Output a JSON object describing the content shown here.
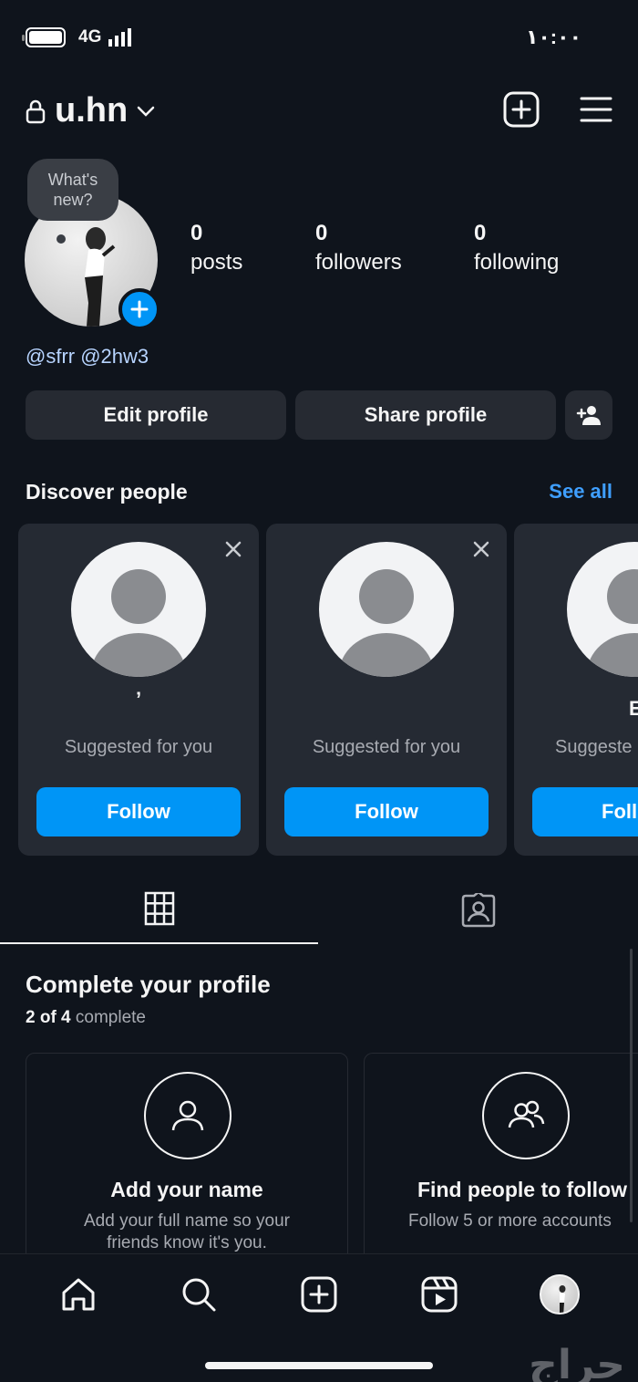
{
  "status_bar": {
    "time": "١٠:٠٠",
    "network": "4G"
  },
  "header": {
    "username": "u.hn",
    "icons": [
      "lock-icon",
      "chevron-down-icon",
      "new-post-icon",
      "menu-icon"
    ]
  },
  "profile": {
    "note_bubble": "What's new?",
    "stats": [
      {
        "value": "0",
        "label": "posts"
      },
      {
        "value": "0",
        "label": "followers"
      },
      {
        "value": "0",
        "label": "following"
      }
    ],
    "bio": "@sfrr @2hw3"
  },
  "actions": {
    "edit_profile": "Edit profile",
    "share_profile": "Share profile"
  },
  "discover": {
    "title": "Discover people",
    "see_all": "See all",
    "cards": [
      {
        "name": "’",
        "subtitle": "Suggested for you",
        "follow_label": "Follow"
      },
      {
        "name": "",
        "subtitle": "Suggested for you",
        "follow_label": "Follow"
      },
      {
        "name": "E",
        "subtitle": "Suggeste",
        "follow_label": "Foll"
      }
    ]
  },
  "tabs": [
    "grid-icon",
    "tagged-icon"
  ],
  "complete_profile": {
    "title": "Complete your profile",
    "progress_done": "2 of 4",
    "progress_suffix": "complete",
    "cards": [
      {
        "title": "Add your name",
        "desc_line1": "Add your full name so your",
        "desc_line2": "friends know it's you."
      },
      {
        "title": "Find people to follow",
        "desc_line1": "Follow 5 or more accounts",
        "desc_line2": ""
      }
    ]
  },
  "bottom_nav": [
    "home-icon",
    "search-icon",
    "create-icon",
    "reels-icon",
    "profile-avatar"
  ],
  "watermark": "حراج",
  "colors": {
    "background": "#0f141c",
    "button": "#262a32",
    "accent": "#0095f6",
    "link": "#3f9fff"
  }
}
